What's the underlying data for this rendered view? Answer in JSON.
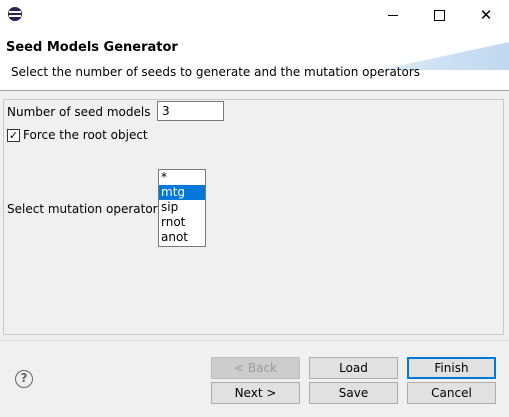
{
  "window": {
    "icon": "eclipse-icon",
    "minimize_icon": "minimize-icon",
    "maximize_icon": "maximize-icon",
    "close_glyph": "✕"
  },
  "header": {
    "title": "Seed Models Generator",
    "description": "Select the number of seeds to generate and the mutation operators"
  },
  "form": {
    "seed_label": "Number of seed models",
    "seed_value": "3",
    "force_root_label": "Force the root object",
    "force_root_checked": true,
    "force_root_mark": "✓",
    "operators_label": "Select mutation operator(s)",
    "operators": [
      "*",
      "mtg",
      "sip",
      "rnot",
      "anot"
    ],
    "selected_operator": "mtg"
  },
  "footer": {
    "help_glyph": "?",
    "back": "< Back",
    "load": "Load",
    "finish": "Finish",
    "next": "Next >",
    "save": "Save",
    "cancel": "Cancel"
  },
  "colors": {
    "selection": "#0078d7",
    "default_button_border": "#0078d7"
  }
}
